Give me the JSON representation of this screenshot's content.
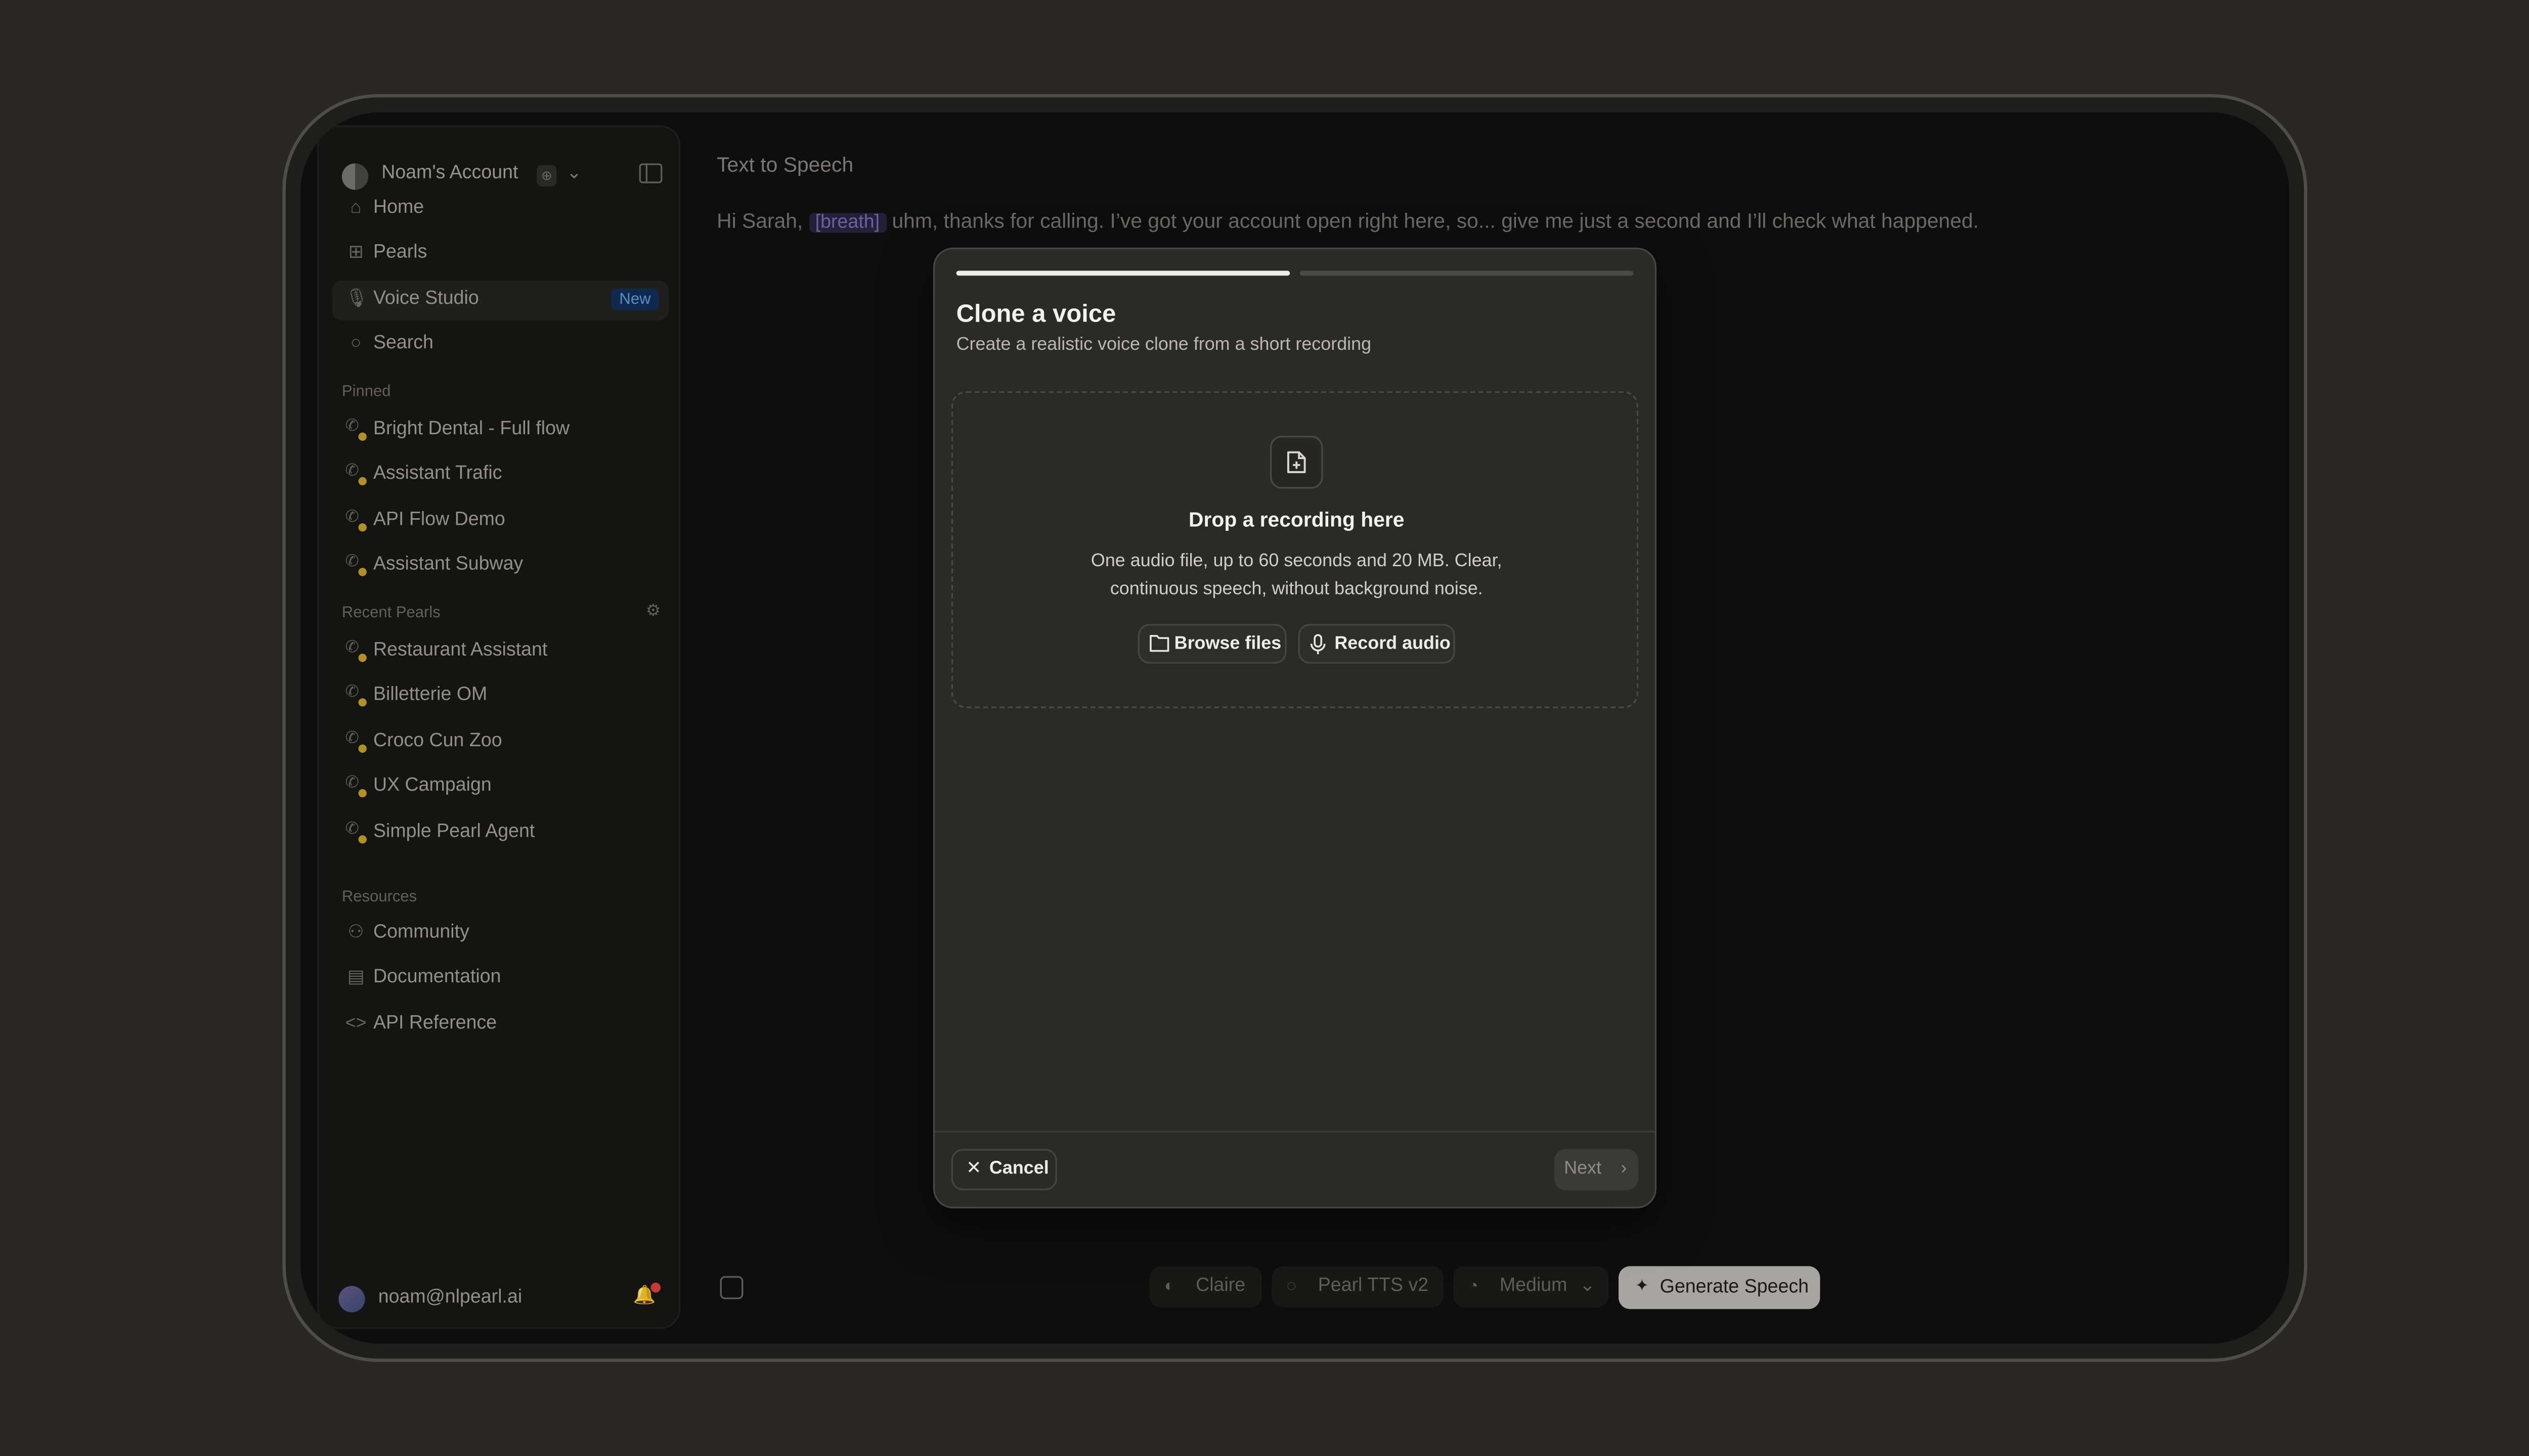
{
  "account": {
    "name": "Noam's Account",
    "badge": "⊕"
  },
  "nav": [
    {
      "label": "Home",
      "icon": "home-icon"
    },
    {
      "label": "Pearls",
      "icon": "grid-icon"
    },
    {
      "label": "Voice Studio",
      "icon": "mic-icon",
      "badge": "New"
    },
    {
      "label": "Search",
      "icon": "search-icon"
    }
  ],
  "sections": {
    "pinned": "Pinned",
    "recent": "Recent Pearls",
    "resources": "Resources"
  },
  "pinned": [
    "Bright Dental - Full flow",
    "Assistant Trafic",
    "API Flow Demo",
    "Assistant Subway"
  ],
  "recent": [
    "Restaurant Assistant",
    "Billetterie OM",
    "Croco Cun Zoo",
    "UX Campaign",
    "Simple Pearl Agent"
  ],
  "resources": [
    {
      "label": "Community",
      "icon": "people-icon"
    },
    {
      "label": "Documentation",
      "icon": "book-icon"
    },
    {
      "label": "API Reference",
      "icon": "code-icon"
    }
  ],
  "user": {
    "email": "noam@nlpearl.ai"
  },
  "tts": {
    "title": "Text to Speech",
    "text_before": "Hi Sarah, ",
    "tag": "[breath]",
    "text_after": " uhm, thanks for calling. I’ve got your account open right here, so... give me just a second and I’ll check what happened."
  },
  "controls": {
    "voice": "Claire",
    "model": "Pearl TTS v2",
    "speed": "Medium",
    "generate": "Generate Speech"
  },
  "modal": {
    "progress_step": 1,
    "progress_total": 2,
    "title": "Clone a voice",
    "subtitle": "Create a realistic voice clone from a short recording",
    "drop_title": "Drop a recording here",
    "drop_desc": "One audio file, up to 60 seconds and 20 MB. Clear, continuous speech, without background noise.",
    "browse": "Browse files",
    "record": "Record audio",
    "cancel": "Cancel",
    "next": "Next"
  },
  "colors": {
    "accent_new": "#6aa0e0",
    "pin_dot": "#c9a62c",
    "notif": "#e0443c"
  }
}
